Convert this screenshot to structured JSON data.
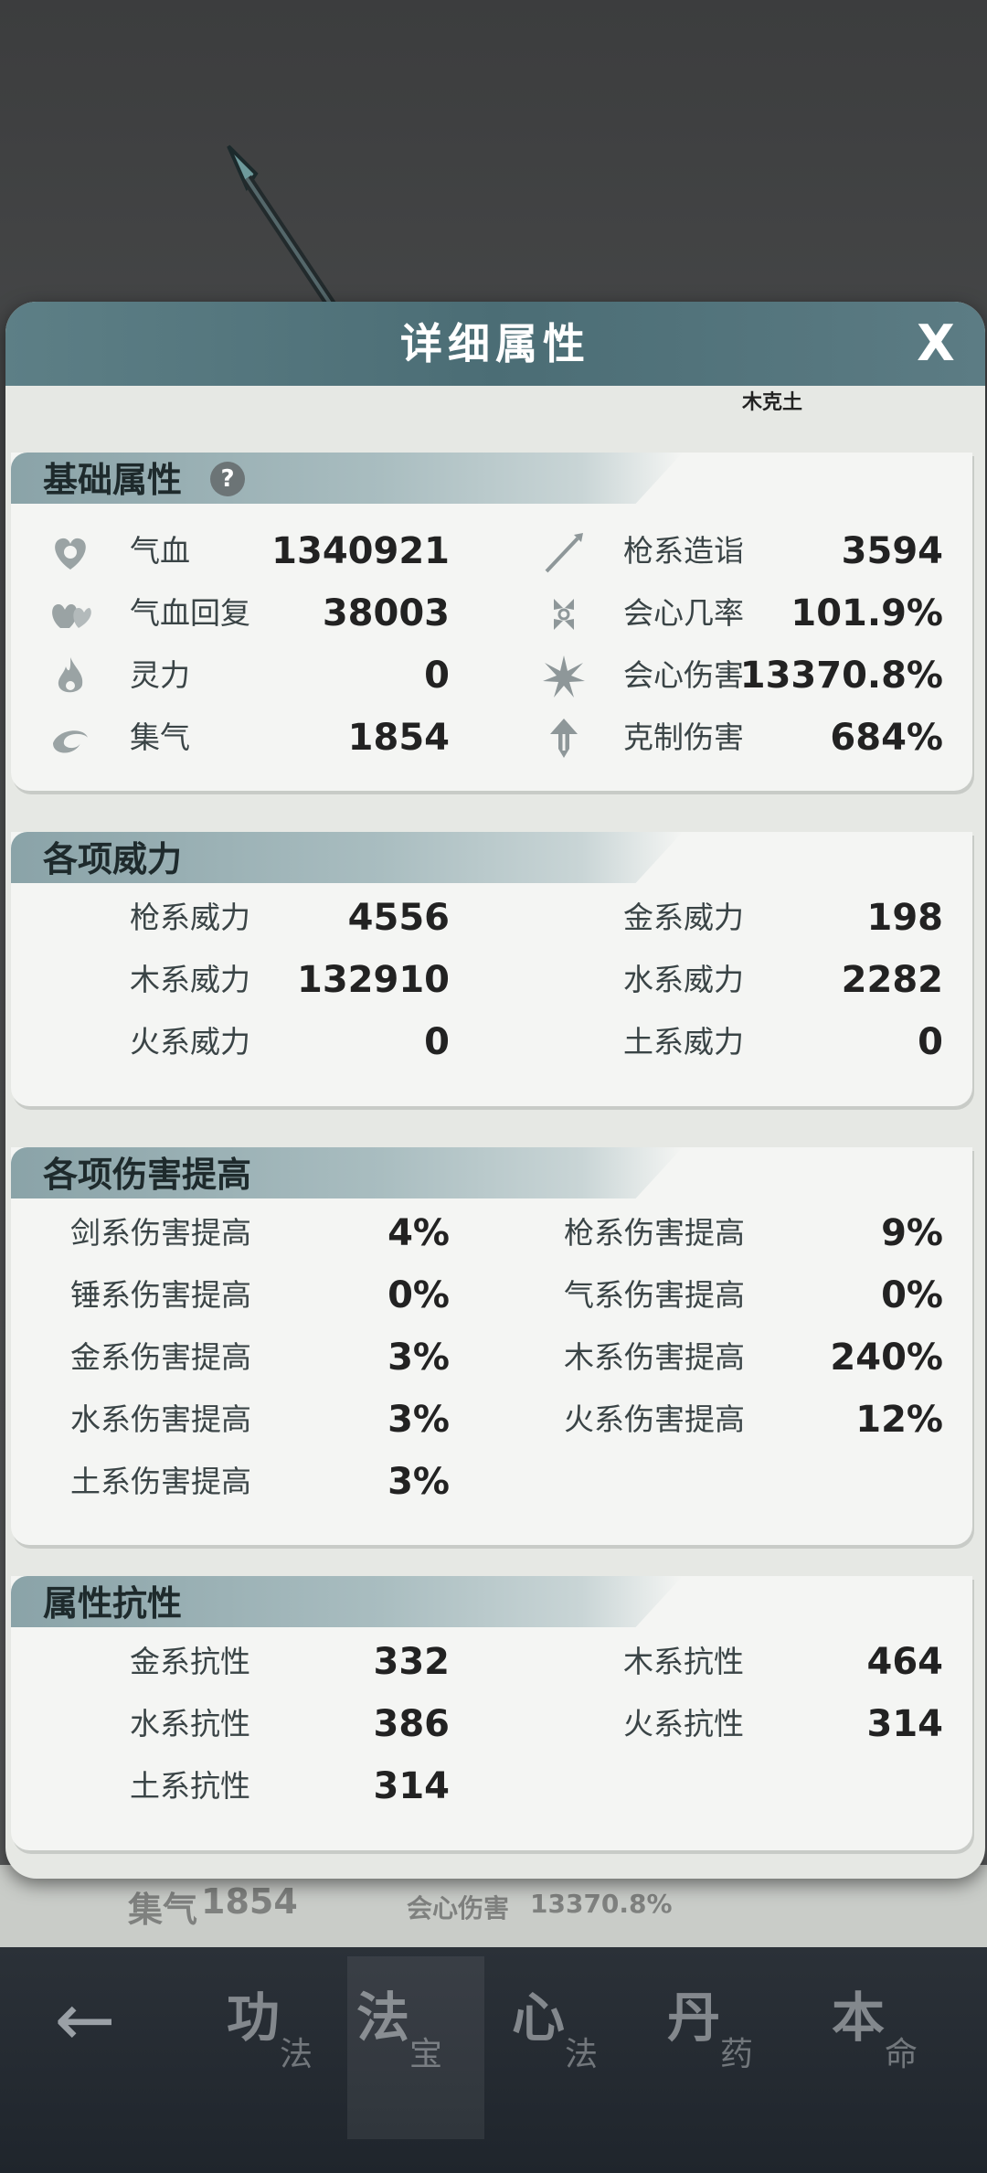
{
  "dialog": {
    "title": "详细属性",
    "close_label": "X",
    "note": "木克土"
  },
  "basic": {
    "title": "基础属性",
    "help_label": "?",
    "left": [
      {
        "icon": "heart-icon",
        "label": "气血",
        "value": "1340921"
      },
      {
        "icon": "heart-regen-icon",
        "label": "气血回复",
        "value": "38003"
      },
      {
        "icon": "flame-icon",
        "label": "灵力",
        "value": "0"
      },
      {
        "icon": "swirl-icon",
        "label": "集气",
        "value": "1854"
      }
    ],
    "right": [
      {
        "icon": "spear-icon",
        "label": "枪系造诣",
        "value": "3594"
      },
      {
        "icon": "crit-rate-icon",
        "label": "会心几率",
        "value": "101.9%"
      },
      {
        "icon": "burst-icon",
        "label": "会心伤害",
        "value": "13370.8%"
      },
      {
        "icon": "counter-arrow-icon",
        "label": "克制伤害",
        "value": "684%"
      }
    ]
  },
  "power": {
    "title": "各项威力",
    "left": [
      {
        "label": "枪系威力",
        "value": "4556"
      },
      {
        "label": "木系威力",
        "value": "132910"
      },
      {
        "label": "火系威力",
        "value": "0"
      }
    ],
    "right": [
      {
        "label": "金系威力",
        "value": "198"
      },
      {
        "label": "水系威力",
        "value": "2282"
      },
      {
        "label": "土系威力",
        "value": "0"
      }
    ]
  },
  "damage": {
    "title": "各项伤害提高",
    "left": [
      {
        "label": "剑系伤害提高",
        "value": "4%"
      },
      {
        "label": "锤系伤害提高",
        "value": "0%"
      },
      {
        "label": "金系伤害提高",
        "value": "3%"
      },
      {
        "label": "水系伤害提高",
        "value": "3%"
      },
      {
        "label": "土系伤害提高",
        "value": "3%"
      }
    ],
    "right": [
      {
        "label": "枪系伤害提高",
        "value": "9%"
      },
      {
        "label": "气系伤害提高",
        "value": "0%"
      },
      {
        "label": "木系伤害提高",
        "value": "240%"
      },
      {
        "label": "火系伤害提高",
        "value": "12%"
      }
    ]
  },
  "resist": {
    "title": "属性抗性",
    "left": [
      {
        "label": "金系抗性",
        "value": "332"
      },
      {
        "label": "水系抗性",
        "value": "386"
      },
      {
        "label": "土系抗性",
        "value": "314"
      }
    ],
    "right": [
      {
        "label": "木系抗性",
        "value": "464"
      },
      {
        "label": "火系抗性",
        "value": "314"
      }
    ]
  },
  "background_strip": {
    "label": "集气",
    "value": "1854",
    "label2": "会心伤害",
    "value2": "13370.8%"
  },
  "nav": {
    "back_icon": "back-arrow-icon",
    "tabs": [
      {
        "big": "功",
        "small": "法"
      },
      {
        "big": "法",
        "small": "宝",
        "active": true
      },
      {
        "big": "心",
        "small": "法"
      },
      {
        "big": "丹",
        "small": "药"
      },
      {
        "big": "本",
        "small": "命"
      }
    ]
  }
}
